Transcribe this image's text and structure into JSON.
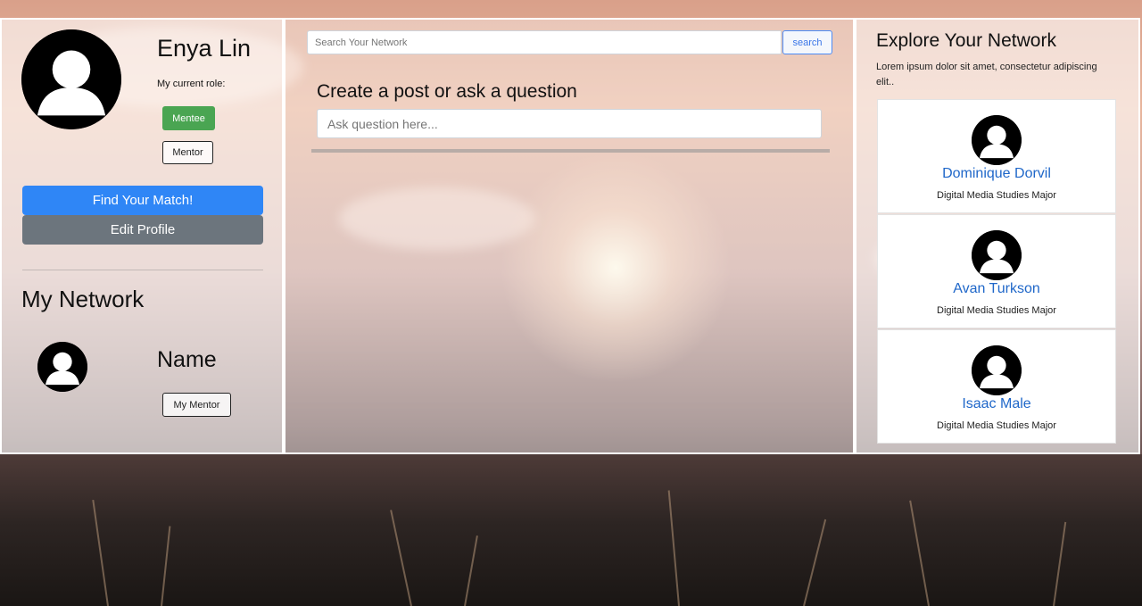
{
  "profile": {
    "name": "Enya Lin",
    "role_label": "My current role:",
    "role_mentee": "Mentee",
    "role_mentor": "Mentor",
    "find_match": "Find Your Match!",
    "edit_profile": "Edit Profile"
  },
  "network": {
    "heading": "My Network",
    "member_name": "Name",
    "member_role": "My Mentor"
  },
  "search": {
    "placeholder": "Search Your Network",
    "button": "search"
  },
  "post": {
    "title": "Create a post or ask a question",
    "placeholder": "Ask question here..."
  },
  "explore": {
    "title": "Explore Your Network",
    "description": "Lorem ipsum dolor sit amet, consectetur adipiscing elit..",
    "people": [
      {
        "name": "Dominique Dorvil",
        "major": "Digital Media Studies Major"
      },
      {
        "name": "Avan Turkson",
        "major": "Digital Media Studies Major"
      },
      {
        "name": "Isaac Male",
        "major": "Digital Media Studies Major"
      }
    ]
  },
  "colors": {
    "accent_blue": "#2f86f6",
    "mentee_green": "#4aa552",
    "link_blue": "#1f67c9",
    "edit_gray": "#6c757d"
  }
}
